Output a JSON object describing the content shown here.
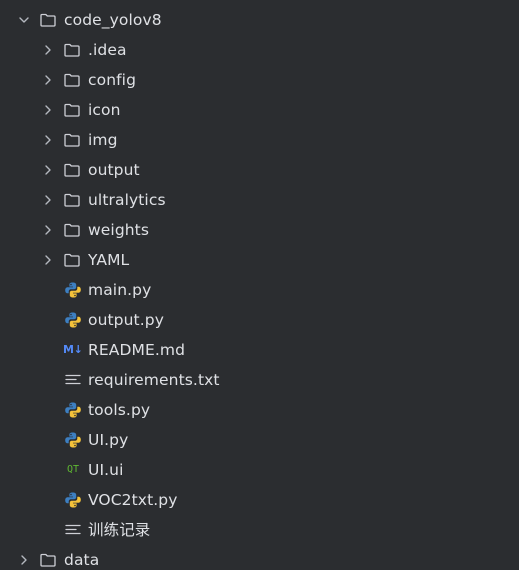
{
  "project_tree": {
    "root": {
      "label": "code_yolov8",
      "expanded": true,
      "icon": "folder-icon"
    },
    "items": [
      {
        "label": ".idea",
        "type": "folder",
        "icon": "folder-icon",
        "expanded": false
      },
      {
        "label": "config",
        "type": "folder",
        "icon": "folder-icon",
        "expanded": false
      },
      {
        "label": "icon",
        "type": "folder",
        "icon": "folder-icon",
        "expanded": false
      },
      {
        "label": "img",
        "type": "folder",
        "icon": "folder-icon",
        "expanded": false
      },
      {
        "label": "output",
        "type": "folder",
        "icon": "folder-icon",
        "expanded": false
      },
      {
        "label": "ultralytics",
        "type": "folder",
        "icon": "folder-icon",
        "expanded": false
      },
      {
        "label": "weights",
        "type": "folder",
        "icon": "folder-icon",
        "expanded": false
      },
      {
        "label": "YAML",
        "type": "folder",
        "icon": "folder-icon",
        "expanded": false
      },
      {
        "label": "main.py",
        "type": "file",
        "icon": "python-file-icon"
      },
      {
        "label": "output.py",
        "type": "file",
        "icon": "python-file-icon"
      },
      {
        "label": "README.md",
        "type": "file",
        "icon": "markdown-file-icon"
      },
      {
        "label": "requirements.txt",
        "type": "file",
        "icon": "text-file-icon"
      },
      {
        "label": "tools.py",
        "type": "file",
        "icon": "python-file-icon"
      },
      {
        "label": "UI.py",
        "type": "file",
        "icon": "python-file-icon"
      },
      {
        "label": "UI.ui",
        "type": "file",
        "icon": "qt-ui-file-icon"
      },
      {
        "label": "VOC2txt.py",
        "type": "file",
        "icon": "python-file-icon"
      },
      {
        "label": "训练记录",
        "type": "file",
        "icon": "text-file-icon"
      }
    ],
    "sibling": {
      "label": "data",
      "type": "folder",
      "icon": "folder-icon",
      "expanded": false
    }
  },
  "icon_glyphs": {
    "markdown": "M↓",
    "qt": "QT"
  },
  "colors": {
    "background": "#2b2d30",
    "text": "#dfe1e5",
    "chevron": "#b4b8bf",
    "folder_outline": "#ced0d6",
    "python_blue": "#3d7fc1",
    "python_yellow": "#f5c33b",
    "markdown_blue": "#548af7",
    "qt_green": "#5fb832"
  }
}
